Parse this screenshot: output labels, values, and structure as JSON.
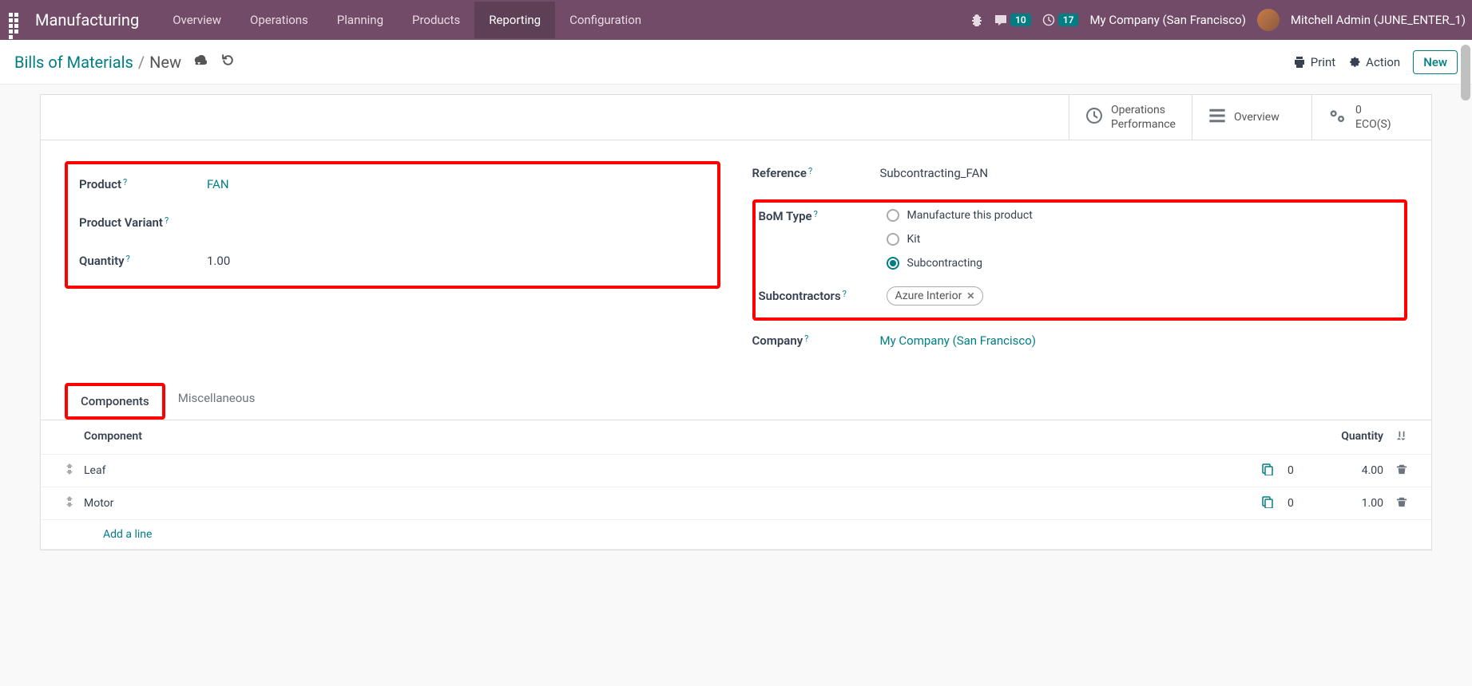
{
  "top": {
    "app_title": "Manufacturing",
    "menu": [
      "Overview",
      "Operations",
      "Planning",
      "Products",
      "Reporting",
      "Configuration"
    ],
    "active_menu": 4,
    "msg_count": "10",
    "act_count": "17",
    "company": "My Company (San Francisco)",
    "user": "Mitchell Admin (JUNE_ENTER_1)"
  },
  "sub": {
    "bc_link": "Bills of Materials",
    "bc_current": "New",
    "print": "Print",
    "action": "Action",
    "new": "New"
  },
  "stats": {
    "ops1": "Operations",
    "ops2": "Performance",
    "overview": "Overview",
    "eco_n": "0",
    "eco_l": "ECO(S)"
  },
  "fields": {
    "product_lbl": "Product",
    "product_val": "FAN",
    "variant_lbl": "Product Variant",
    "variant_val": "",
    "qty_lbl": "Quantity",
    "qty_val": "1.00",
    "ref_lbl": "Reference",
    "ref_val": "Subcontracting_FAN",
    "bom_lbl": "BoM Type",
    "bom_opts": [
      "Manufacture this product",
      "Kit",
      "Subcontracting"
    ],
    "bom_sel": 2,
    "sub_lbl": "Subcontractors",
    "sub_tag": "Azure Interior",
    "comp_lbl": "Company",
    "comp_val": "My Company (San Francisco)"
  },
  "tabs": [
    "Components",
    "Miscellaneous"
  ],
  "table": {
    "h_comp": "Component",
    "h_qty": "Quantity",
    "rows": [
      {
        "name": "Leaf",
        "mid": "0",
        "qty": "4.00"
      },
      {
        "name": "Motor",
        "mid": "0",
        "qty": "1.00"
      }
    ],
    "add": "Add a line"
  }
}
